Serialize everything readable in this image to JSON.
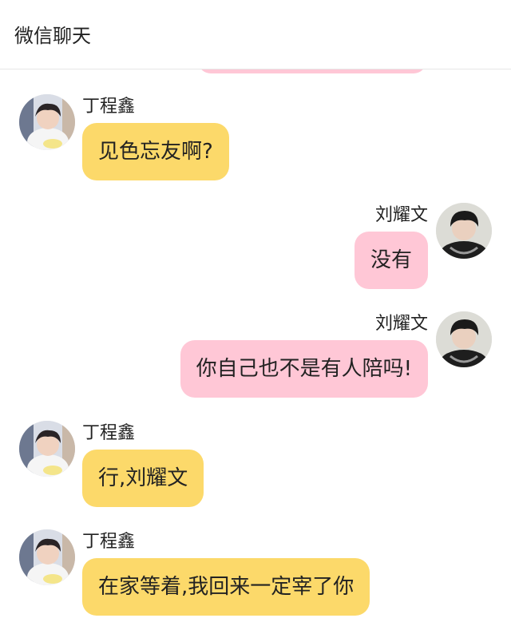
{
  "header": {
    "title": "微信聊天"
  },
  "colors": {
    "incoming_bubble": "#fcd96a",
    "outgoing_bubble": "#ffc7d6"
  },
  "messages": [
    {
      "side": "left",
      "sender": "丁程鑫",
      "text": "见色忘友啊?",
      "avatar": "avatar-ding"
    },
    {
      "side": "right",
      "sender": "刘耀文",
      "text": "没有",
      "avatar": "avatar-liu"
    },
    {
      "side": "right",
      "sender": "刘耀文",
      "text": "你自己也不是有人陪吗!",
      "avatar": "avatar-liu"
    },
    {
      "side": "left",
      "sender": "丁程鑫",
      "text": "行,刘耀文",
      "avatar": "avatar-ding"
    },
    {
      "side": "left",
      "sender": "丁程鑫",
      "text": "在家等着,我回来一定宰了你",
      "avatar": "avatar-ding"
    }
  ]
}
